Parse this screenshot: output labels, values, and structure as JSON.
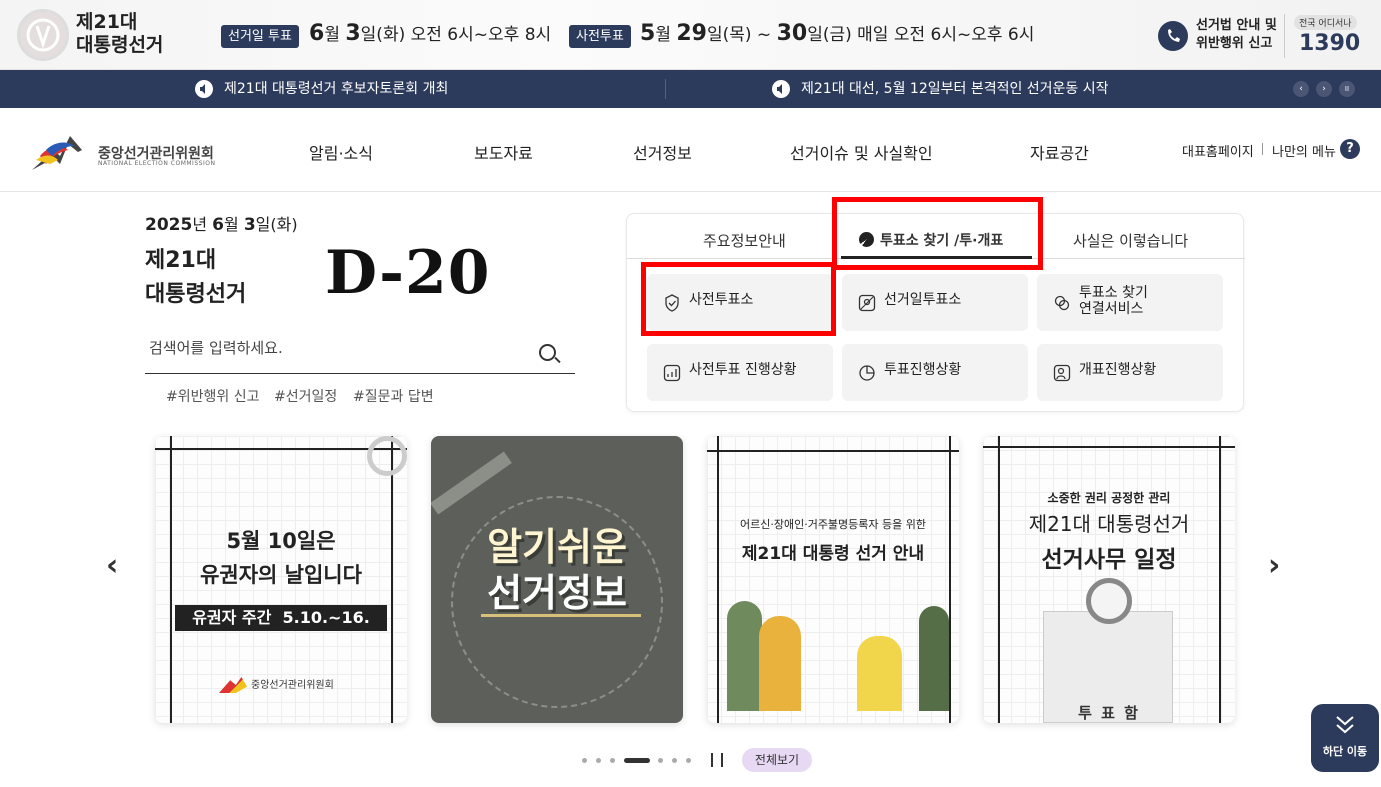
{
  "top": {
    "title_line1": "제21대",
    "title_line2": "대통령선거",
    "election_day_badge": "선거일 투표",
    "election_day_month": "6",
    "election_day_month_unit": "월",
    "election_day_day": "3",
    "election_day_rest": "일(화) 오전 6시~오후 8시",
    "early_vote_badge": "사전투표",
    "early_vote_m1": "5",
    "early_vote_u1": "월",
    "early_vote_d1": "29",
    "early_vote_mid": "일(목) ~",
    "early_vote_d2": "30",
    "early_vote_rest": "일(금) 매일 오전 6시~오후 6시",
    "hotline_line1": "선거법 안내 및",
    "hotline_line2": "위반행위 신고",
    "hotline_small": "전국 어디서나",
    "hotline_number": "1390"
  },
  "news": {
    "item1": "제21대 대통령선거 후보자토론회 개최",
    "item2": "제21대 대선, 5월 12일부터 본격적인 선거운동 시작",
    "prev": "‹",
    "next": "›",
    "pause": "II"
  },
  "gnb": {
    "org_name": "중앙선거관리위원회",
    "org_en": "NATIONAL ELECTION COMMISSION",
    "menu": [
      "알림·소식",
      "보도자료",
      "선거정보",
      "선거이슈 및 사실확인",
      "자료공간"
    ],
    "util_home": "대표홈페이지",
    "util_my": "나만의 메뉴",
    "help": "?"
  },
  "hero": {
    "date_year": "2025",
    "date_y_unit": "년",
    "date_month": "6",
    "date_m_unit": "월",
    "date_day": "3",
    "date_rest": "일(화)",
    "elec_line1": "제21대",
    "elec_line2": "대통령선거",
    "dday": "D-20",
    "search_placeholder": "검색어를 입력하세요.",
    "tags": [
      "#위반행위 신고",
      "#선거일정",
      "#질문과 답변"
    ]
  },
  "panel": {
    "tabs": [
      "주요정보안내",
      "투표소 찾기 /투·개표",
      "사실은 이렇습니다"
    ],
    "active_tab": 1,
    "buttons": [
      {
        "label": "사전투표소",
        "icon": "check-circle-icon"
      },
      {
        "label": "선거일투표소",
        "icon": "map-pin-icon"
      },
      {
        "label": "투표소 찾기",
        "label2": "연결서비스",
        "icon": "link-icon"
      },
      {
        "label": "사전투표 진행상황",
        "icon": "bar-chart-icon"
      },
      {
        "label": "투표진행상황",
        "icon": "pie-chart-icon"
      },
      {
        "label": "개표진행상황",
        "icon": "person-check-icon"
      }
    ]
  },
  "cards": {
    "c1_line1": "5월 10일은",
    "c1_line2": "유권자의 날입니다",
    "c1_banner": "유권자 주간  5.10.~16.",
    "c1_org": "중앙선거관리위원회",
    "c2_line1": "알기쉬운",
    "c2_line2": "선거정보",
    "c3_sub": "어르신·장애인·거주불명등록자 등을 위한",
    "c3_title": "제21대 대통령 선거 안내",
    "c4_sub": "소중한 권리 공정한 관리",
    "c4_title1": "제21대 대통령선거",
    "c4_title2": "선거사무 일정",
    "c4_box": "투 표 함"
  },
  "carousel": {
    "prev": "‹",
    "next": "›",
    "all": "전체보기",
    "bottom_btn": "하단 이동"
  },
  "colors": {
    "navy": "#2c3a5c",
    "highlight": "#ff0000",
    "all_btn": "#e7d9f3"
  }
}
